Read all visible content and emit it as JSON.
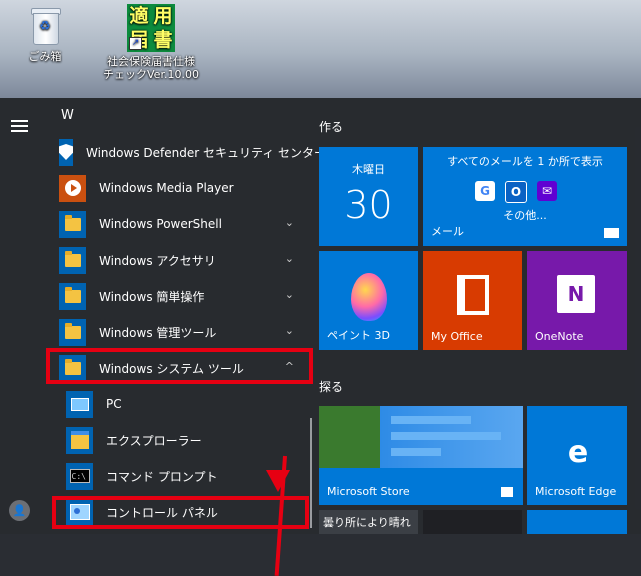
{
  "desktop": {
    "recycle_bin_label": "ごみ箱",
    "app_icon_glyphs": [
      "適",
      "用",
      "届",
      "書"
    ],
    "app_label_line1": "社会保険届書仕様",
    "app_label_line2": "チェックVer.10.00"
  },
  "app_list": {
    "section_letter": "W",
    "items": [
      {
        "label": "Windows Defender セキュリティ センター",
        "icon": "shield-icon"
      },
      {
        "label": "Windows Media Player",
        "icon": "media-player-icon"
      },
      {
        "label": "Windows PowerShell",
        "icon": "folder-icon",
        "expandable": true
      },
      {
        "label": "Windows アクセサリ",
        "icon": "folder-icon",
        "expandable": true
      },
      {
        "label": "Windows 簡単操作",
        "icon": "folder-icon",
        "expandable": true
      },
      {
        "label": "Windows 管理ツール",
        "icon": "folder-icon",
        "expandable": true
      },
      {
        "label": "Windows システム ツール",
        "icon": "folder-icon",
        "expanded": true
      }
    ],
    "subitems": [
      {
        "label": "PC",
        "icon": "pc-icon"
      },
      {
        "label": "エクスプローラー",
        "icon": "file-explorer-icon"
      },
      {
        "label": "コマンド プロンプト",
        "icon": "command-prompt-icon"
      },
      {
        "label": "コントロール パネル",
        "icon": "control-panel-icon"
      }
    ],
    "chevron_down": "⌄",
    "chevron_up": "^"
  },
  "tiles": {
    "group1_title": "作る",
    "calendar": {
      "day": "木曜日",
      "date": "30"
    },
    "mail": {
      "headline": "すべてのメールを 1 か所で表示",
      "more": "その他...",
      "label": "メール"
    },
    "paint3d": {
      "label": "ペイント 3D"
    },
    "office": {
      "label": "My Office"
    },
    "onenote": {
      "label": "OneNote",
      "glyph": "N"
    },
    "group2_title": "探る",
    "store": {
      "label": "Microsoft Store"
    },
    "edge": {
      "label": "Microsoft Edge",
      "glyph": "e"
    },
    "weather": {
      "label": "曇り所により晴れ"
    }
  },
  "colors": {
    "highlight": "#e60012",
    "tile_blue": "#0078d7",
    "tile_orange": "#d83b01",
    "tile_purple": "#7719aa"
  }
}
